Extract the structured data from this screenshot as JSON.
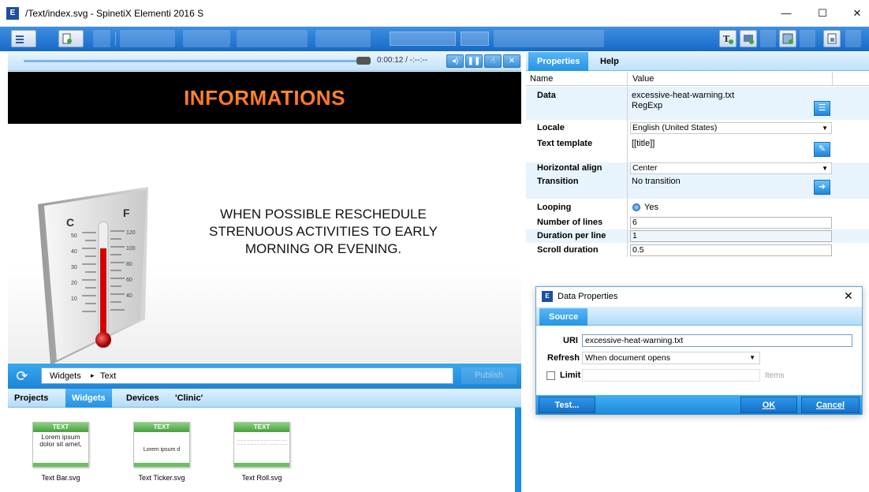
{
  "window": {
    "title": "/Text/index.svg - SpinetiX Elementi 2016 S",
    "app_icon_label": "E",
    "minimize": "—",
    "maximize": "☐",
    "close": "✕"
  },
  "player": {
    "time": "0:00:12 / -:--:--"
  },
  "preview": {
    "banner_title": "INFORMATIONS",
    "message": "WHEN POSSIBLE RESCHEDULE STRENUOUS ACTIVITIES TO EARLY MORNING OR EVENING.",
    "thermo_left_unit": "C",
    "thermo_right_unit": "F",
    "celsius_ticks": [
      "50",
      "40",
      "30",
      "20",
      "10"
    ],
    "fahrenheit_ticks": [
      "120",
      "100",
      "80",
      "60",
      "40"
    ]
  },
  "widgets_bar": {
    "path_root": "Widgets",
    "path_arrow": "▸",
    "path_current": "Text",
    "publish_label": "Publish"
  },
  "bottom_tabs": [
    "Projects",
    "Widgets",
    "Devices",
    "'Clinic'"
  ],
  "library": {
    "items": [
      {
        "head": "TEXT",
        "body": "Lorem ipsum dolor sit amet,",
        "name": "Text Bar.svg"
      },
      {
        "head": "TEXT",
        "body": "Lorem ipsum d",
        "name": "Text Ticker.svg"
      },
      {
        "head": "TEXT",
        "body": "·········· ··········· ·········· ········ ····· ·········· ·········· ········· ········· ········",
        "name": "Text Roll.svg"
      }
    ]
  },
  "properties": {
    "tabs": [
      "Properties",
      "Help"
    ],
    "col_name": "Name",
    "col_value": "Value",
    "rows": {
      "data": {
        "name": "Data",
        "value1": "excessive-heat-warning.txt",
        "value2": "RegExp"
      },
      "locale": {
        "name": "Locale",
        "value": "English (United States)"
      },
      "text_template": {
        "name": "Text template",
        "value": "[[title]]"
      },
      "horizontal_align": {
        "name": "Horizontal align",
        "value": "Center"
      },
      "transition": {
        "name": "Transition",
        "value": "No transition"
      },
      "looping": {
        "name": "Looping",
        "value": "Yes"
      },
      "number_of_lines": {
        "name": "Number of lines",
        "value": "6"
      },
      "duration_per_line": {
        "name": "Duration per line",
        "value": "1"
      },
      "scroll_duration": {
        "name": "Scroll duration",
        "value": "0.5"
      }
    }
  },
  "dialog": {
    "title": "Data Properties",
    "close": "✕",
    "tab": "Source",
    "uri_label": "URI",
    "uri_value": "excessive-heat-warning.txt",
    "refresh_label": "Refresh",
    "refresh_value": "When document opens",
    "limit_label": "Limit",
    "limit_placeholder": "Items",
    "test_button": "Test...",
    "ok_button": "OK",
    "cancel_button": "Cancel"
  }
}
